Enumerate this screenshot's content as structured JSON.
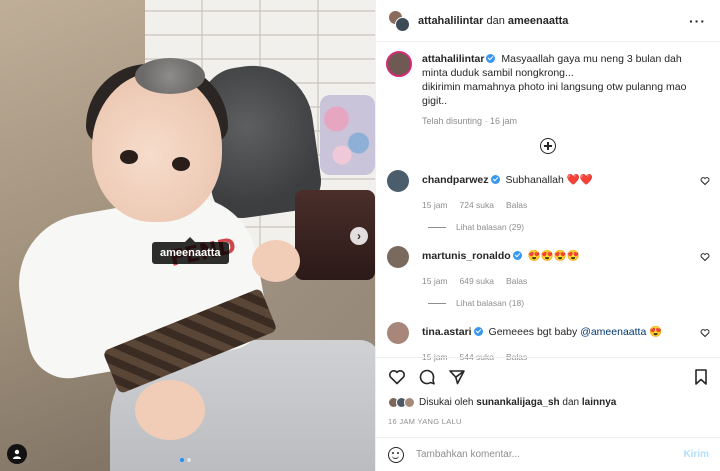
{
  "photo": {
    "tag_label": "ameenaatta",
    "print_text": "FEND",
    "next_icon": "chevron-right-icon",
    "user_tag_icon": "user-icon"
  },
  "header": {
    "user1": "attahalilintar",
    "joiner": "dan",
    "user2": "ameenaatta",
    "more_icon": "ellipsis-icon"
  },
  "caption": {
    "username": "attahalilintar",
    "text_line1": "Masyaallah gaya mu neng 3 bulan dah minta duduk sambil nongkrong...",
    "text_line2": "dikirimin mamahnya photo ini langsung otw pulanng mao gigit..",
    "edited": "Telah disunting · 16 jam"
  },
  "comments": [
    {
      "username": "chandparwez",
      "verified": true,
      "text": "Subhanallah ❤️❤️",
      "time": "15 jam",
      "likes": "724 suka",
      "reply": "Balas",
      "view_replies": "Lihat balasan (29)"
    },
    {
      "username": "martunis_ronaldo",
      "verified": true,
      "text": "😍😍😍😍",
      "time": "15 jam",
      "likes": "649 suka",
      "reply": "Balas",
      "view_replies": "Lihat balasan (18)"
    },
    {
      "username": "tina.astari",
      "verified": true,
      "text": "Gemeees bgt baby",
      "mention": "@ameenaatta",
      "emoji": "😍",
      "time": "15 jam",
      "likes": "544 suka",
      "reply": "Balas"
    }
  ],
  "likes": {
    "prefix": "Disukai oleh",
    "user": "sunankalijaga_sh",
    "joiner": "dan",
    "others": "lainnya"
  },
  "time_ago": "16 JAM YANG LALU",
  "add_comment": {
    "placeholder": "Tambahkan komentar...",
    "post_label": "Kirim"
  },
  "colors": {
    "verified": "#3897f0",
    "story_ring": "#d62976",
    "post_disabled": "#b2dffc",
    "muted": "#8e8e8e"
  }
}
